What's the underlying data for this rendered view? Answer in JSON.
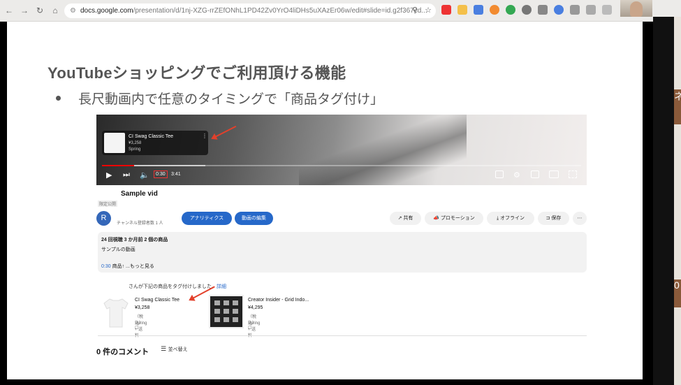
{
  "browser": {
    "back": "←",
    "forward": "→",
    "reload": "↻",
    "home": "⌂",
    "url_domain": "docs.google.com",
    "url_path": "/presentation/d/1nj-XZG-rrZEfONhL1PD42Zv0YrO4liDHs5uXAzEr06w/edit#slide=id.g2f367cd...",
    "zoom_icon": "⚲",
    "star_icon": "☆",
    "download_icon": "⤓"
  },
  "slide": {
    "title": "YouTubeショッピングでご利用頂ける機能",
    "bullet": "長尺動画内で任意のタイミングで「商品タグ付け」"
  },
  "player": {
    "card_name": "CI Swag Classic Tee",
    "card_price": "¥3,258",
    "card_store": "Spring",
    "card_more": "⋮",
    "current_time": "0:30",
    "duration": "3:41",
    "progress_fraction": 0.135
  },
  "video_info": {
    "title": "Sample vid",
    "visibility": "限定公開",
    "avatar_letter": "R",
    "subscribers": "チャンネル登録者数 1 人",
    "analytics_btn": "アナリティクス",
    "edit_btn": "動画の編集",
    "share_btn": "共有",
    "promote_btn": "プロモーション",
    "offline_btn": "オフライン",
    "save_btn": "保存",
    "more_btn": "⋯"
  },
  "description": {
    "stats": "24 回視聴  3 か月前  2 個の商品",
    "text": "サンプルの動画",
    "timestamp": "0:30",
    "suffix": " 商品↑  ...もっと見る"
  },
  "tagged": {
    "note": "さんが下記の商品をタグ付けしました。",
    "detail_link": "詳細"
  },
  "products": [
    {
      "name": "CI Swag Classic Tee",
      "price": "¥3,258",
      "tax": "（税込）+ 送料",
      "store": "Spring ☐"
    },
    {
      "name": "Creator Insider - Grid Indo...",
      "price": "¥4,295",
      "tax": "（税込）+ 送料",
      "store": "Spring ☐"
    }
  ],
  "comments": {
    "count_label": "0 件のコメント",
    "sort_label": "並べ替え"
  },
  "side_panel": {
    "glyph1": "ネ",
    "glyph2": "0"
  },
  "colors": {
    "accent_blue": "#2668c9",
    "annotation_red": "#e3402b",
    "progress_red": "#ee0000"
  }
}
